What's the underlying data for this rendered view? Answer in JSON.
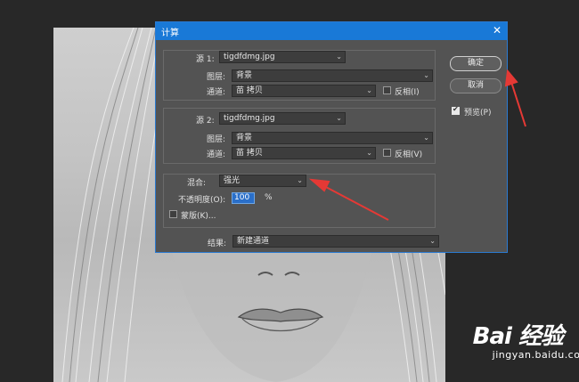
{
  "dialog": {
    "title": "计算",
    "close_glyph": "✕",
    "source1": {
      "label": "源 1:",
      "file": "tigdfdmg.jpg",
      "layer_label": "图层:",
      "layer": "背景",
      "channel_label": "通道:",
      "channel": "苗 拷贝",
      "invert_label": "反相(I)",
      "invert_checked": false
    },
    "source2": {
      "label": "源 2:",
      "file": "tigdfdmg.jpg",
      "layer_label": "图层:",
      "layer": "背景",
      "channel_label": "通道:",
      "channel": "苗 拷贝",
      "invert_label": "反相(V)",
      "invert_checked": false
    },
    "blend": {
      "label": "混合:",
      "mode": "强光",
      "opacity_label": "不透明度(O):",
      "opacity": "100",
      "unit": "%",
      "mask_label": "蒙版(K)...",
      "mask_checked": false
    },
    "result": {
      "label": "结果:",
      "value": "新建通道"
    },
    "ok_label": "确定",
    "cancel_label": "取消",
    "preview_label": "预览(P)",
    "preview_checked": true
  },
  "watermark": {
    "brand": "Bai 经验",
    "url": "jingyan.baidu.com"
  },
  "colors": {
    "titlebar": "#1979d7",
    "dialog_bg": "#535353",
    "arrow": "#e53935",
    "app_bg": "#282828"
  },
  "icons": [
    "dropdown-chevron-icon",
    "close-icon",
    "checkbox-icon",
    "red-arrow-annotation",
    "baidu-paw-icon"
  ]
}
